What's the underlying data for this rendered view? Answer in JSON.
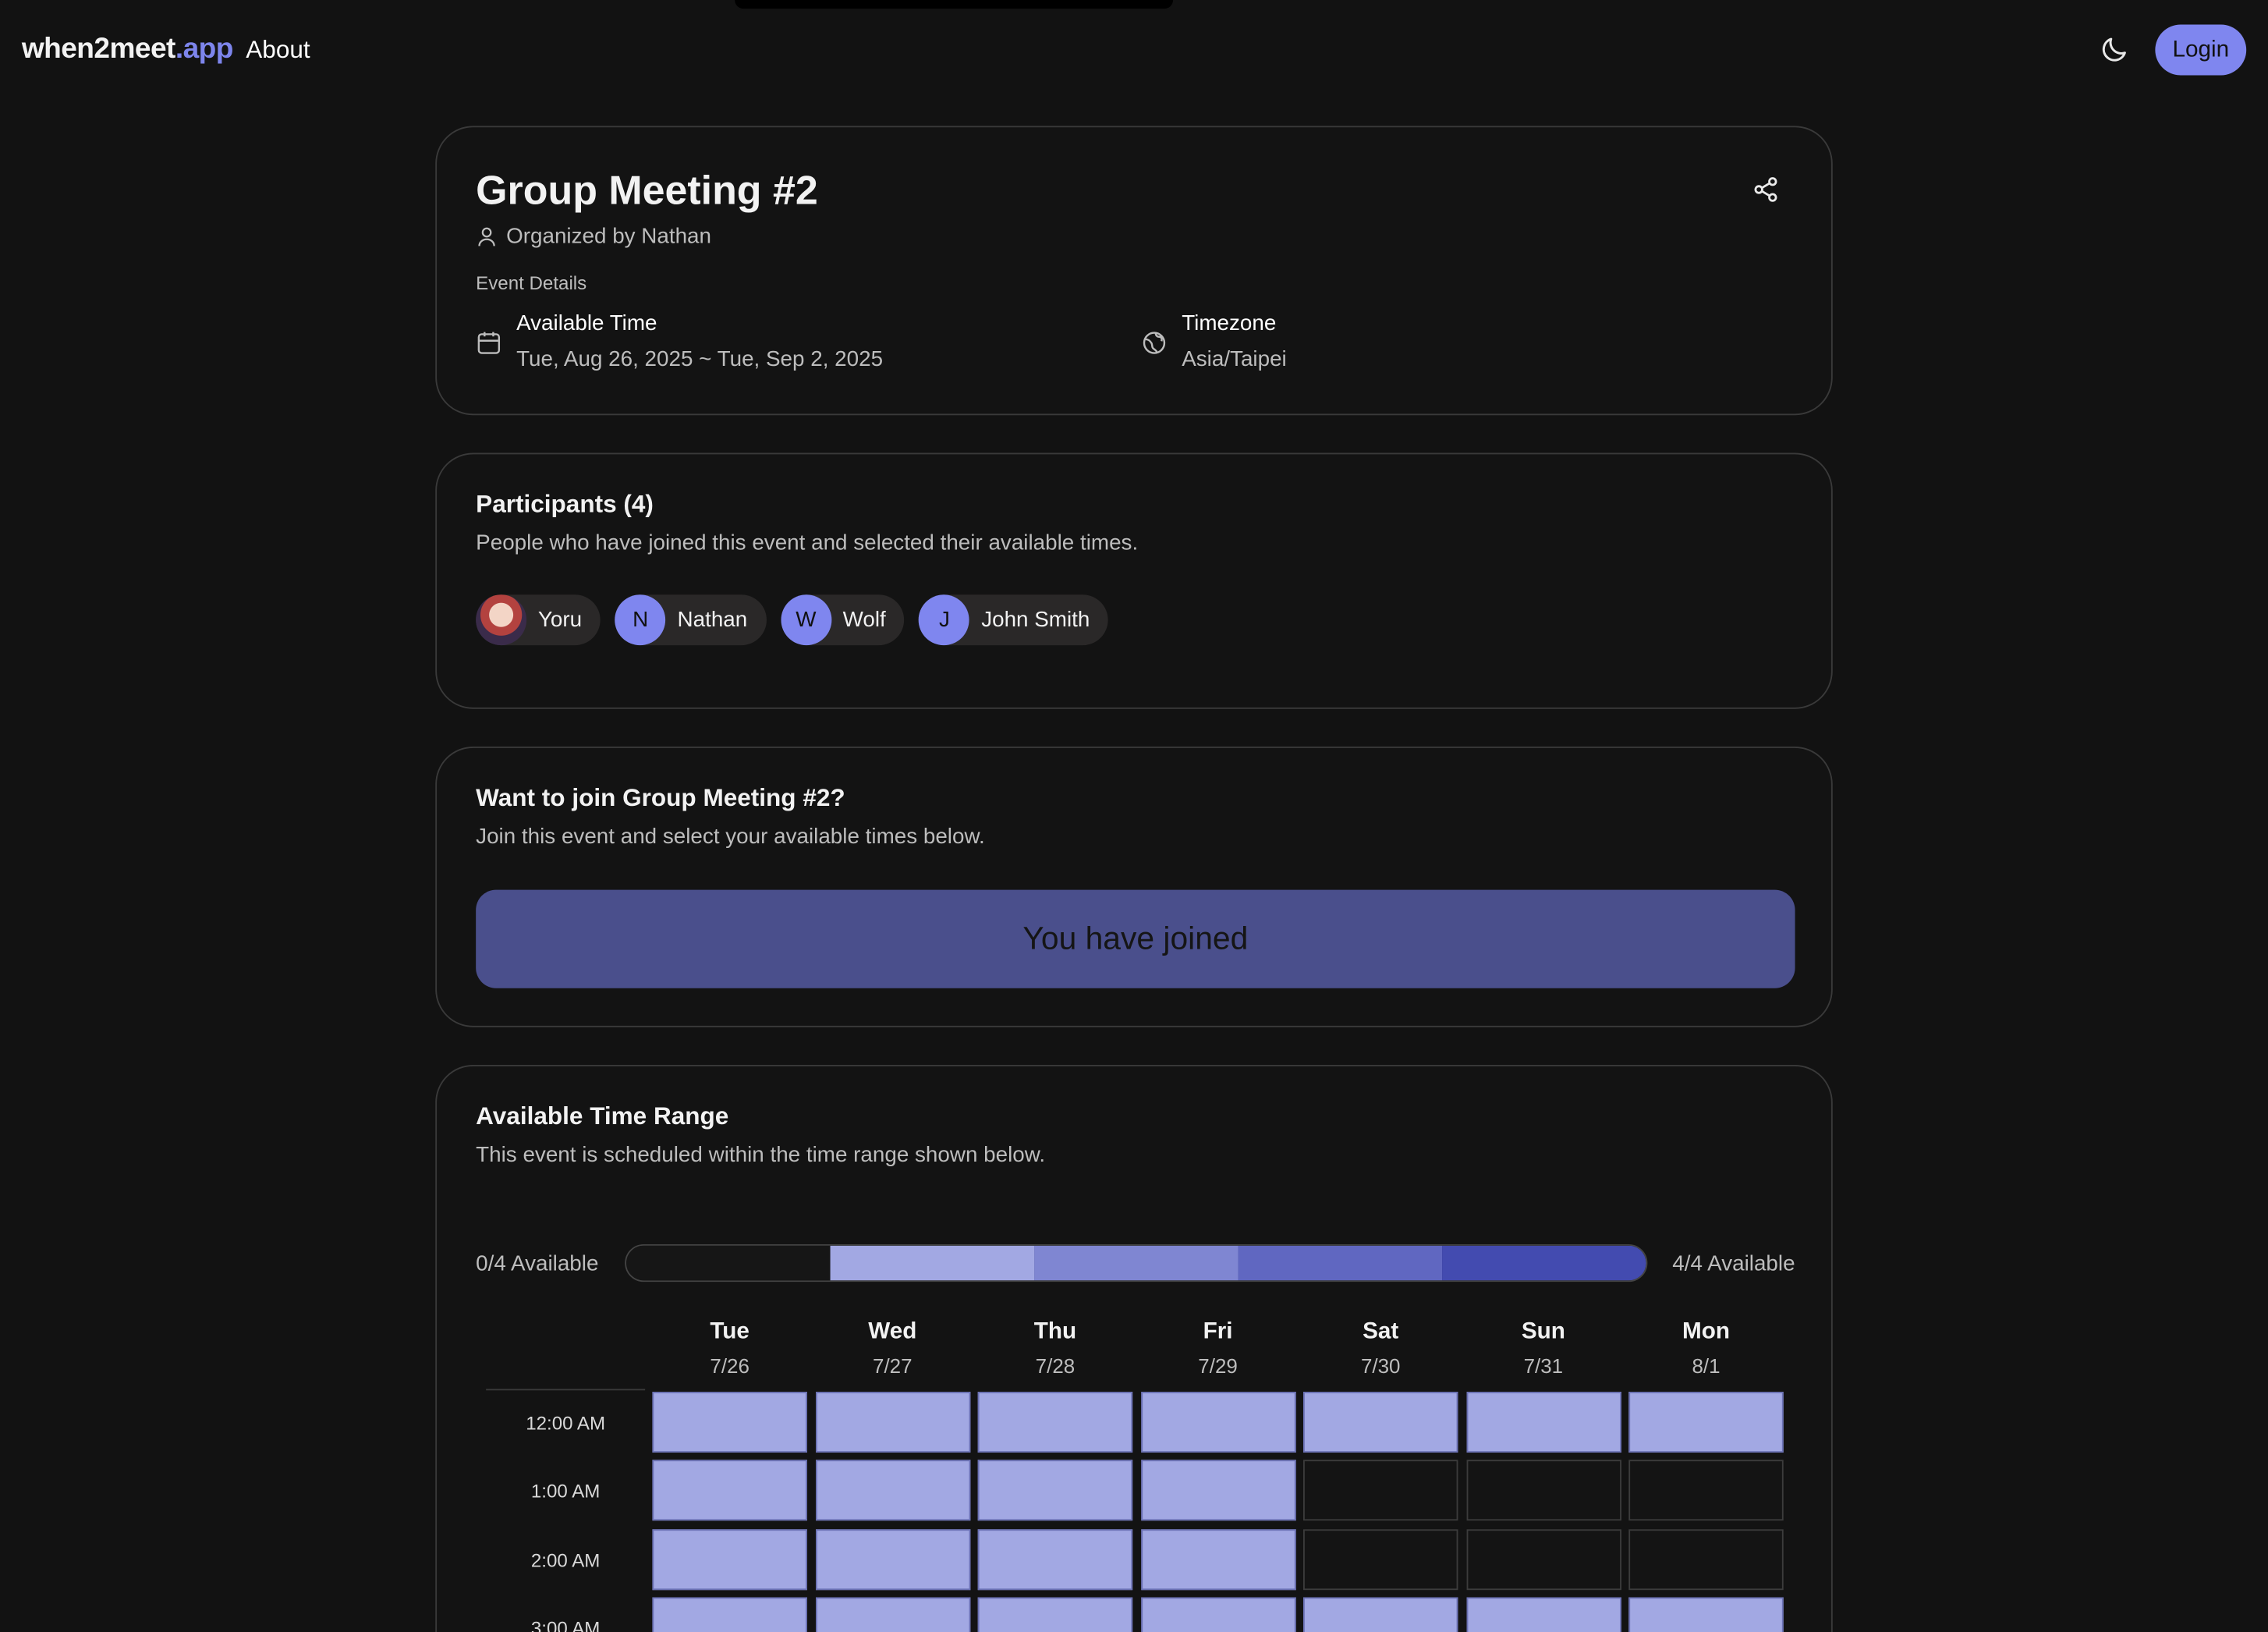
{
  "header": {
    "brand_main": "when2meet",
    "brand_suffix": ".app",
    "about": "About",
    "theme_icon": "moon-icon",
    "login": "Login"
  },
  "event": {
    "title": "Group Meeting #2",
    "organizer": "Organized by Nathan",
    "details_label": "Event Details",
    "available_time_label": "Available Time",
    "available_time_value": "Tue, Aug 26, 2025 ~ Tue, Sep 2, 2025",
    "timezone_label": "Timezone",
    "timezone_value": "Asia/Taipei"
  },
  "participants": {
    "title": "Participants (4)",
    "subtitle": "People who have joined this event and selected their available times.",
    "list": [
      {
        "initial": "",
        "name": "Yoru",
        "has_photo": true
      },
      {
        "initial": "N",
        "name": "Nathan",
        "has_photo": false
      },
      {
        "initial": "W",
        "name": "Wolf",
        "has_photo": false
      },
      {
        "initial": "J",
        "name": "John Smith",
        "has_photo": false
      }
    ]
  },
  "join": {
    "title": "Want to join Group Meeting #2?",
    "subtitle": "Join this event and select your available times below.",
    "button": "You have joined"
  },
  "availability": {
    "title": "Available Time Range",
    "subtitle": "This event is scheduled within the time range shown below.",
    "legend_min": "0/4 Available",
    "legend_max": "4/4 Available",
    "legend_colors": [
      "#161616",
      "#a2a8e3",
      "#7f86d2",
      "#6067c1",
      "#434bb0"
    ],
    "filled_color": "#a2a8e3",
    "days": [
      {
        "name": "Tue",
        "date": "7/26"
      },
      {
        "name": "Wed",
        "date": "7/27"
      },
      {
        "name": "Thu",
        "date": "7/28"
      },
      {
        "name": "Fri",
        "date": "7/29"
      },
      {
        "name": "Sat",
        "date": "7/30"
      },
      {
        "name": "Sun",
        "date": "7/31"
      },
      {
        "name": "Mon",
        "date": "8/1"
      }
    ],
    "times": [
      "12:00 AM",
      "1:00 AM",
      "2:00 AM",
      "3:00 AM"
    ],
    "slots": [
      [
        1,
        1,
        1,
        1,
        1,
        1,
        1
      ],
      [
        1,
        1,
        1,
        1,
        0,
        0,
        0
      ],
      [
        1,
        1,
        1,
        1,
        0,
        0,
        0
      ],
      [
        1,
        1,
        1,
        1,
        1,
        1,
        1
      ]
    ]
  }
}
